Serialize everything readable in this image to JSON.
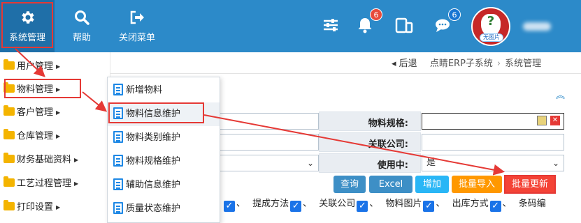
{
  "header": {
    "buttons": [
      {
        "label": "系统管理",
        "icon": "gear-icon"
      },
      {
        "label": "帮助",
        "icon": "search-icon"
      },
      {
        "label": "关闭菜单",
        "icon": "exit-icon"
      }
    ],
    "notifications_count": "6",
    "messages_count": "6",
    "avatar_text": "无图片"
  },
  "breadcrumb": {
    "back": "后退",
    "items": [
      "点睛ERP子系统",
      "系统管理"
    ]
  },
  "sidebar": {
    "items": [
      {
        "label": "用户管理"
      },
      {
        "label": "物料管理"
      },
      {
        "label": "客户管理"
      },
      {
        "label": "仓库管理"
      },
      {
        "label": "财务基础资料"
      },
      {
        "label": "工艺过程管理"
      },
      {
        "label": "打印设置"
      }
    ]
  },
  "submenu": {
    "items": [
      {
        "label": "新增物料"
      },
      {
        "label": "物料信息维护"
      },
      {
        "label": "物料类别维护"
      },
      {
        "label": "物料规格维护"
      },
      {
        "label": "辅助信息维护"
      },
      {
        "label": "质量状态维护"
      }
    ]
  },
  "form": {
    "spec_label": "物料规格:",
    "company_label": "关联公司:",
    "active_label": "使用中:",
    "active_value": "是"
  },
  "actions": {
    "query": "查询",
    "excel": "Excel",
    "add": "增加",
    "batch_import": "批量导入",
    "batch_update": "批量更新"
  },
  "columns": [
    "提成方法",
    "关联公司",
    "物料图片",
    "出库方式",
    "条码编"
  ],
  "colors": {
    "header_bg": "#2c8ac9",
    "annotation_red": "#e53935",
    "query_btn": "#3d8fc6",
    "excel_btn": "#3d8fc6",
    "add_btn": "#29b6f6",
    "import_btn": "#ff9800",
    "update_btn": "#f44336",
    "badge_red": "#e74c3c",
    "badge_blue": "#1976d2"
  }
}
